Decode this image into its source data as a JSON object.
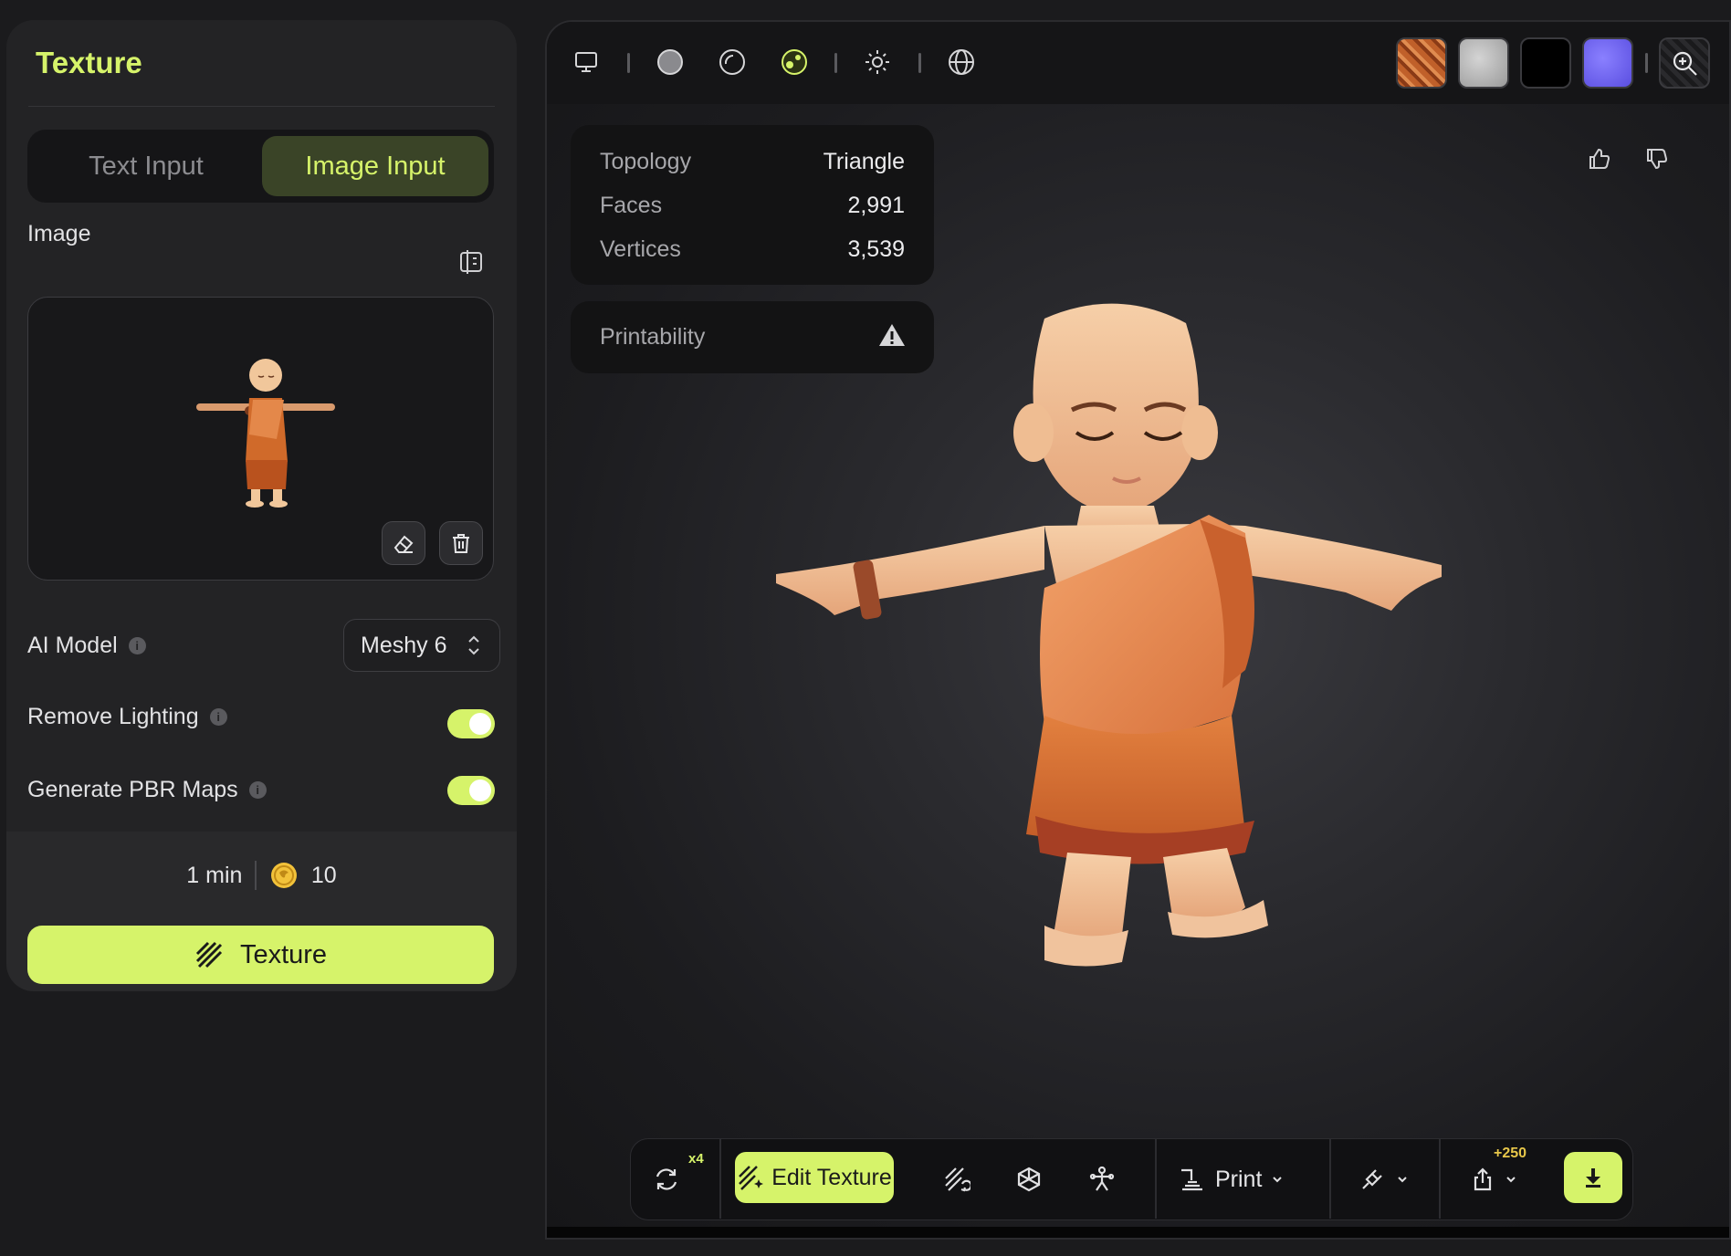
{
  "panel": {
    "title": "Texture",
    "tabs": [
      {
        "label": "Text Input",
        "active": false
      },
      {
        "label": "Image Input",
        "active": true
      }
    ],
    "image_label": "Image",
    "ai_model_label": "AI Model",
    "ai_model_value": "Meshy 6",
    "remove_lighting_label": "Remove Lighting",
    "remove_lighting_on": true,
    "generate_pbr_label": "Generate PBR Maps",
    "generate_pbr_on": true,
    "info_glyph": "i",
    "time": "1 min",
    "credits": "10",
    "texture_button": "Texture"
  },
  "viewer": {
    "stats": {
      "topology_label": "Topology",
      "topology_value": "Triangle",
      "faces_label": "Faces",
      "faces_value": "2,991",
      "vertices_label": "Vertices",
      "vertices_value": "3,539"
    },
    "printability_label": "Printability",
    "texture_swatches": [
      "base-color",
      "roughness",
      "metallic",
      "normal"
    ],
    "action_bar": {
      "remesh_badge": "x4",
      "edit_texture_label": "Edit Texture",
      "print_label": "Print",
      "share_badge": "+250"
    }
  },
  "colors": {
    "accent": "#d6f36a",
    "panel_bg": "#232325",
    "viewer_bg": "#151517",
    "badge_gold": "#e8c74a"
  },
  "icons": {
    "toolbar": [
      "monitor-icon",
      "solid-sphere-icon",
      "wireframe-sphere-icon",
      "textured-sphere-icon",
      "sun-icon",
      "globe-icon",
      "zoom-inspect-icon"
    ],
    "action_bar": [
      "refresh-icon",
      "wand-texture-icon",
      "retexture-icon",
      "mesh-icon",
      "rig-icon",
      "printer-icon",
      "plug-icon",
      "share-icon",
      "download-icon"
    ]
  }
}
